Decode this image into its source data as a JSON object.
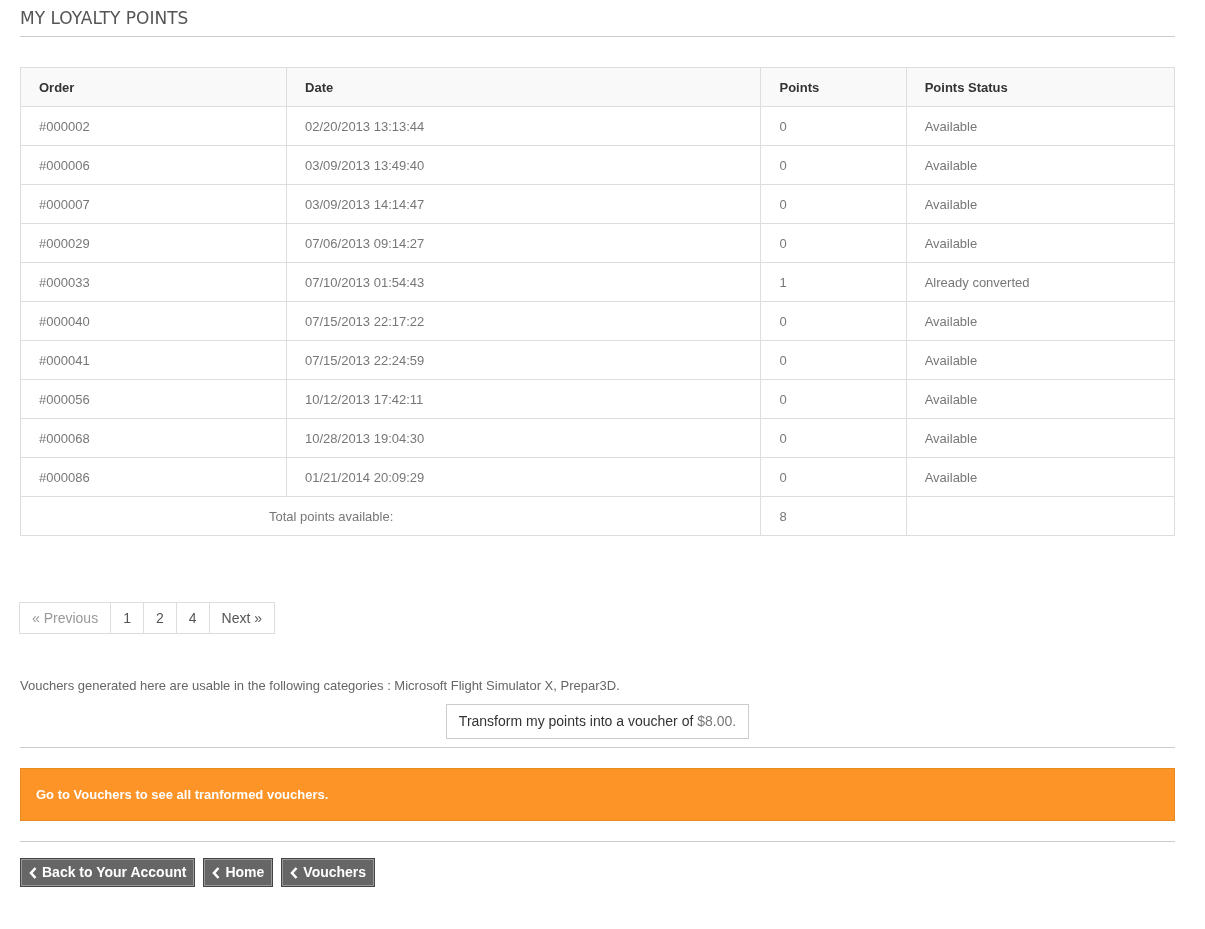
{
  "title": "MY LOYALTY POINTS",
  "table": {
    "columns": [
      "Order",
      "Date",
      "Points",
      "Points Status"
    ],
    "rows": [
      [
        "#000002",
        "02/20/2013 13:13:44",
        "0",
        "Available"
      ],
      [
        "#000006",
        "03/09/2013 13:49:40",
        "0",
        "Available"
      ],
      [
        "#000007",
        "03/09/2013 14:14:47",
        "0",
        "Available"
      ],
      [
        "#000029",
        "07/06/2013 09:14:27",
        "0",
        "Available"
      ],
      [
        "#000033",
        "07/10/2013 01:54:43",
        "1",
        "Already converted"
      ],
      [
        "#000040",
        "07/15/2013 22:17:22",
        "0",
        "Available"
      ],
      [
        "#000041",
        "07/15/2013 22:24:59",
        "0",
        "Available"
      ],
      [
        "#000056",
        "10/12/2013 17:42:11",
        "0",
        "Available"
      ],
      [
        "#000068",
        "10/28/2013 19:04:30",
        "0",
        "Available"
      ],
      [
        "#000086",
        "01/21/2014 20:09:29",
        "0",
        "Available"
      ]
    ],
    "total_label": "Total points available:",
    "total_value": "8"
  },
  "pagination": {
    "previous": "« Previous",
    "pages": [
      "1",
      "2",
      "4"
    ],
    "next": "Next »"
  },
  "note": "Vouchers generated here are usable in the following categories : Microsoft Flight Simulator X, Prepar3D.",
  "transform_button": {
    "label": "Transform my points into a voucher of",
    "amount": "$8.00."
  },
  "alert": "Go to Vouchers to see all tranformed vouchers.",
  "nav_buttons": [
    "Back to Your Account",
    "Home",
    "Vouchers"
  ]
}
